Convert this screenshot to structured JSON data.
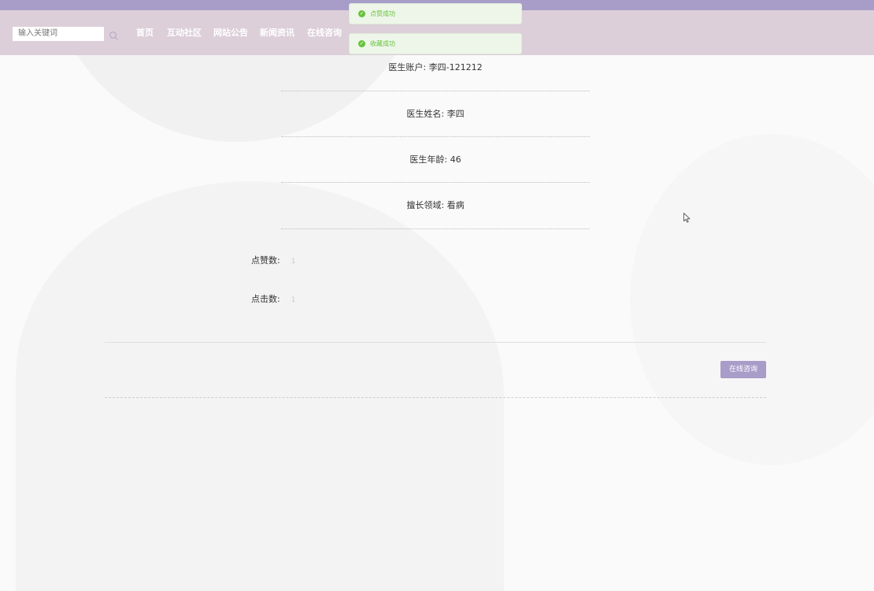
{
  "search": {
    "placeholder": "输入关键词"
  },
  "nav": {
    "items": [
      {
        "label": "首页"
      },
      {
        "label": "互动社区"
      },
      {
        "label": "网站公告"
      },
      {
        "label": "新闻资讯"
      },
      {
        "label": "在线咨询"
      }
    ]
  },
  "toasts": [
    {
      "message": "点赞成功"
    },
    {
      "message": "收藏成功"
    }
  ],
  "doctor": {
    "account": {
      "label": "医生账户:",
      "value": "李四-121212"
    },
    "name": {
      "label": "医生姓名:",
      "value": "李四"
    },
    "age": {
      "label": "医生年龄:",
      "value": "46"
    },
    "specialty": {
      "label": "擅长领域:",
      "value": "看病"
    }
  },
  "stats": {
    "likes": {
      "label": "点赞数:",
      "value": "1"
    },
    "clicks": {
      "label": "点击数:",
      "value": "1"
    }
  },
  "actions": {
    "consult_label": "在线咨询"
  },
  "colors": {
    "accent": "#a89cc8",
    "navbar": "#dccfd9",
    "success": "#67c23a"
  }
}
